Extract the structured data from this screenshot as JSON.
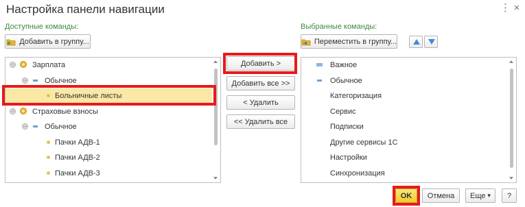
{
  "window": {
    "title": "Настройка панели навигации",
    "menu_glyph": "⋮",
    "close_glyph": "×"
  },
  "available": {
    "label": "Доступные команды:",
    "add_to_group_button": "Добавить в группу...",
    "tree": [
      {
        "label": "Зарплата",
        "level": 0,
        "kind": "folder",
        "expander": "⊖",
        "selected": false
      },
      {
        "label": "Обычное",
        "level": 1,
        "kind": "group",
        "expander": "⊖",
        "selected": false
      },
      {
        "label": "Больничные листы",
        "level": 2,
        "kind": "item",
        "selected": true
      },
      {
        "label": "Страховые взносы",
        "level": 0,
        "kind": "folder",
        "expander": "⊖",
        "selected": false
      },
      {
        "label": "Обычное",
        "level": 1,
        "kind": "group",
        "expander": "⊖",
        "selected": false
      },
      {
        "label": "Пачки АДВ-1",
        "level": 2,
        "kind": "item",
        "selected": false
      },
      {
        "label": "Пачки АДВ-2",
        "level": 2,
        "kind": "item",
        "selected": false
      },
      {
        "label": "Пачки АДВ-3",
        "level": 2,
        "kind": "item",
        "selected": false
      }
    ]
  },
  "middle": {
    "add_button": "Добавить >",
    "add_all_button": "Добавить все >>",
    "remove_button": "< Удалить",
    "remove_all_button": "<< Удалить все"
  },
  "selected": {
    "label": "Выбранные команды:",
    "move_to_group_button": "Переместить в группу...",
    "items": [
      {
        "label": "Важное",
        "kind": "group"
      },
      {
        "label": "Обычное",
        "kind": "group"
      },
      {
        "label": "Категоризация",
        "kind": "item"
      },
      {
        "label": "Сервис",
        "kind": "item"
      },
      {
        "label": "Подписки",
        "kind": "item"
      },
      {
        "label": "Другие сервисы 1С",
        "kind": "item"
      },
      {
        "label": "Настройки",
        "kind": "item"
      },
      {
        "label": "Синхронизация",
        "kind": "item"
      }
    ]
  },
  "footer": {
    "ok_button": "OK",
    "cancel_button": "Отмена",
    "more_button": "Еще",
    "more_caret": "▾",
    "help_button": "?"
  },
  "colors": {
    "section_label": "#3b8a3e",
    "selection": "#fbe8a5",
    "highlight_frame": "#e8191d",
    "ok_button": "#f1cb2b",
    "arrow_icon": "#3f8bd8"
  }
}
